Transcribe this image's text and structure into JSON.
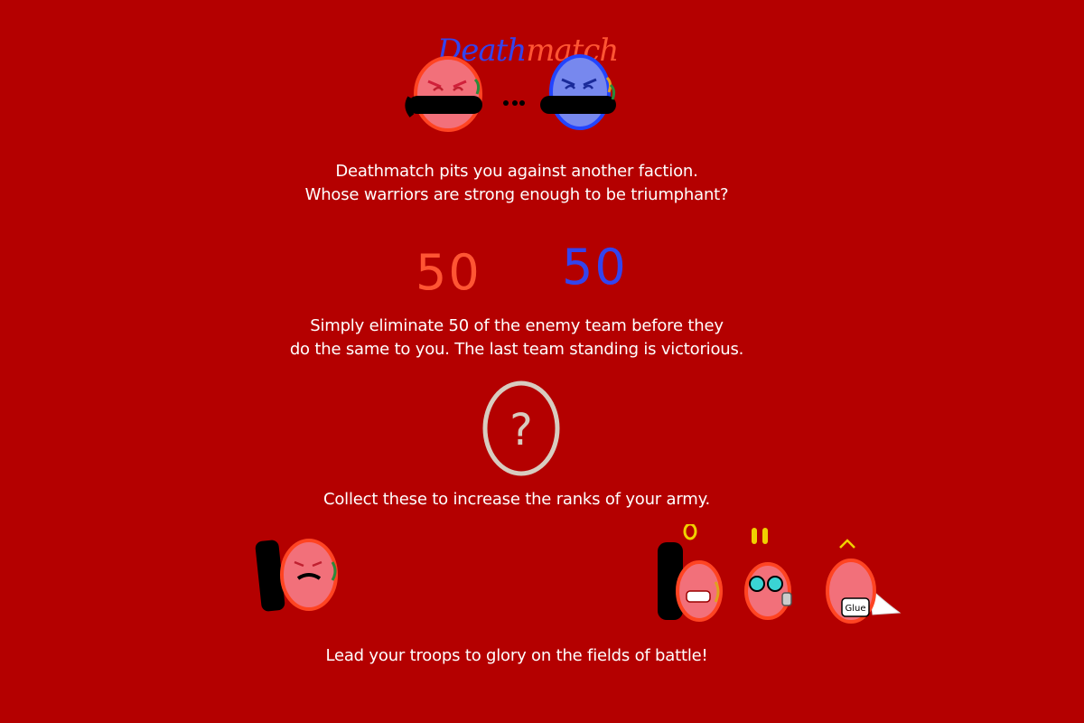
{
  "header": {
    "title_part1": "Death",
    "title_part2": "match"
  },
  "intro": {
    "line1": "Deathmatch pits you against another faction.",
    "line2": "Whose warriors are strong enough to be triumphant?"
  },
  "scores": {
    "red": "50",
    "blue": "50"
  },
  "rules": {
    "line1": "Simply eliminate 50 of the enemy team before they",
    "line2": "do the same to you. The last team standing is victorious."
  },
  "pickup": {
    "symbol": "?",
    "caption": "Collect these to increase the ranks of your army."
  },
  "glue_label": "Glue",
  "footer": {
    "text": "Lead your troops to glory on the fields of battle!"
  },
  "colors": {
    "background": "#b40000",
    "red_team": "#ff5533",
    "blue_team": "#3344ee",
    "pickup_stroke": "#d8ccc0"
  }
}
